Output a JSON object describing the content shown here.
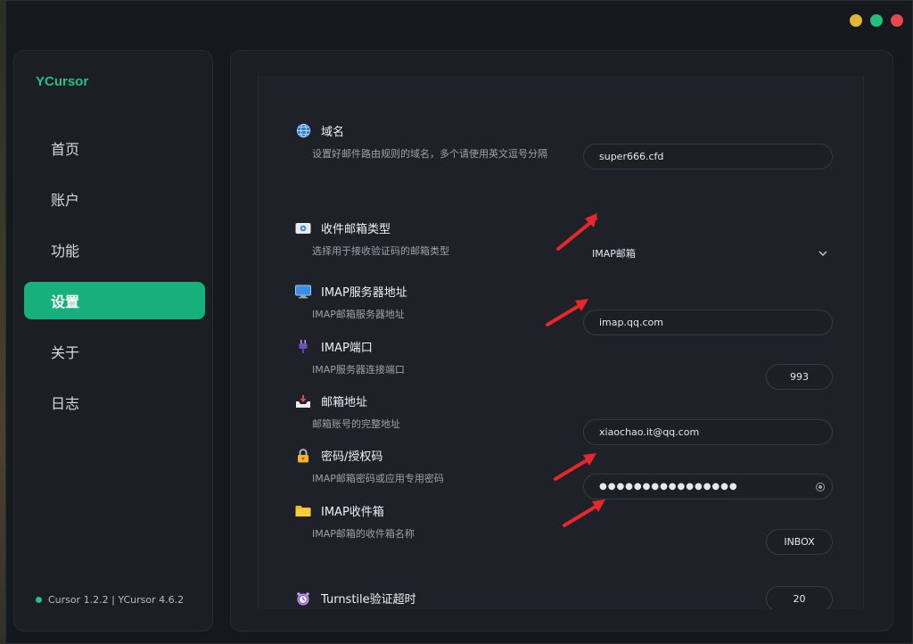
{
  "window": {
    "controls": [
      {
        "name": "minimize",
        "color": "#e2b43a"
      },
      {
        "name": "maximize",
        "color": "#22c07a"
      },
      {
        "name": "close",
        "color": "#e5484d"
      }
    ]
  },
  "sidebar": {
    "brand": "YCursor",
    "items": [
      {
        "id": "home",
        "label": "首页",
        "active": false
      },
      {
        "id": "account",
        "label": "账户",
        "active": false
      },
      {
        "id": "features",
        "label": "功能",
        "active": false
      },
      {
        "id": "settings",
        "label": "设置",
        "active": true
      },
      {
        "id": "about",
        "label": "关于",
        "active": false
      },
      {
        "id": "logs",
        "label": "日志",
        "active": false
      }
    ],
    "version": "Cursor 1.2.2 | YCursor 4.6.2"
  },
  "settings": {
    "domain": {
      "icon": "globe-icon",
      "title": "域名",
      "desc": "设置好邮件路由规则的域名，多个请使用英文逗号分隔",
      "value": "super666.cfd"
    },
    "mailbox_type": {
      "icon": "mailbox-icon",
      "title": "收件邮箱类型",
      "desc": "选择用于接收验证码的邮箱类型",
      "value": "IMAP邮箱"
    },
    "imap_server": {
      "icon": "monitor-icon",
      "title": "IMAP服务器地址",
      "desc": "IMAP邮箱服务器地址",
      "value": "imap.qq.com"
    },
    "imap_port": {
      "icon": "plug-icon",
      "title": "IMAP端口",
      "desc": "IMAP服务器连接端口",
      "value": "993"
    },
    "email": {
      "icon": "inbox-tray-icon",
      "title": "邮箱地址",
      "desc": "邮箱账号的完整地址",
      "value": "xiaochao.it@qq.com"
    },
    "password": {
      "icon": "lock-icon",
      "title": "密码/授权码",
      "desc": "IMAP邮箱密码或应用专用密码",
      "value": "●●●●●●●●●●●●●●●●"
    },
    "imap_folder": {
      "icon": "folder-icon",
      "title": "IMAP收件箱",
      "desc": "IMAP邮箱的收件箱名称",
      "value": "INBOX"
    },
    "turnstile": {
      "icon": "alarm-clock-icon",
      "title": "Turnstile验证超时",
      "value": "20"
    }
  },
  "annotations": {
    "arrow_color": "#e8262b"
  }
}
